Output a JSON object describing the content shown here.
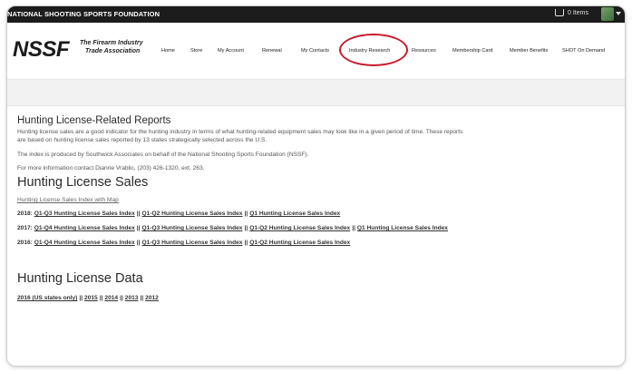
{
  "topbar": {
    "org_name": "NATIONAL SHOOTING SPORTS FOUNDATION",
    "cart_label": "0 Items"
  },
  "header": {
    "logo": "NSSF",
    "tagline_line1": "The Firearm Industry",
    "tagline_line2": "Trade Association",
    "nav": [
      "Home",
      "Store",
      "My Account",
      "Renewal",
      "My Contacts",
      "Industry Research",
      "Resources",
      "Membership Card",
      "Member Benefits",
      "SHOT On Demand"
    ]
  },
  "content": {
    "reports_heading": "Hunting License-Related Reports",
    "intro_line1": "Hunting license sales are a good indicator for the hunting industry in terms of what hunting-related equipment sales may look like in a given period of time. These reports",
    "intro_line2": "are based on hunting license sales reported by 13 states strategically selected across the U.S.",
    "index_note": "The index is produced by Southwick Associates on behalf of the National Shooting Sports Foundation (NSSF).",
    "contact_note": "For more information contact Dianne Vrablic, (203) 426-1320, ext. 263.",
    "sales_heading": "Hunting License Sales",
    "sales_map_link": "Hunting License Sales Index with Map",
    "sales_lines": [
      {
        "year": "2018:",
        "links": [
          "Q1-Q3 Hunting License Sales Index",
          "Q1-Q2 Hunting License Sales Index",
          "Q1 Hunting License Sales Index"
        ]
      },
      {
        "year": "2017:",
        "links": [
          "Q1-Q4 Hunting License Sales Index",
          "Q1-Q3 Hunting License Sales Index",
          "Q1-Q2 Hunting License Sales Index",
          "Q1 Hunting License Sales Index"
        ]
      },
      {
        "year": "2016:",
        "links": [
          "Q1-Q4 Hunting License Sales Index",
          "Q1-Q3 Hunting License Sales Index",
          "Q1-Q2 Hunting License Sales Index"
        ]
      }
    ],
    "separator": "||",
    "data_heading": "Hunting License Data",
    "data_links": [
      "2016 (US states only)",
      "2015",
      "2014",
      "2013",
      "2012"
    ]
  }
}
